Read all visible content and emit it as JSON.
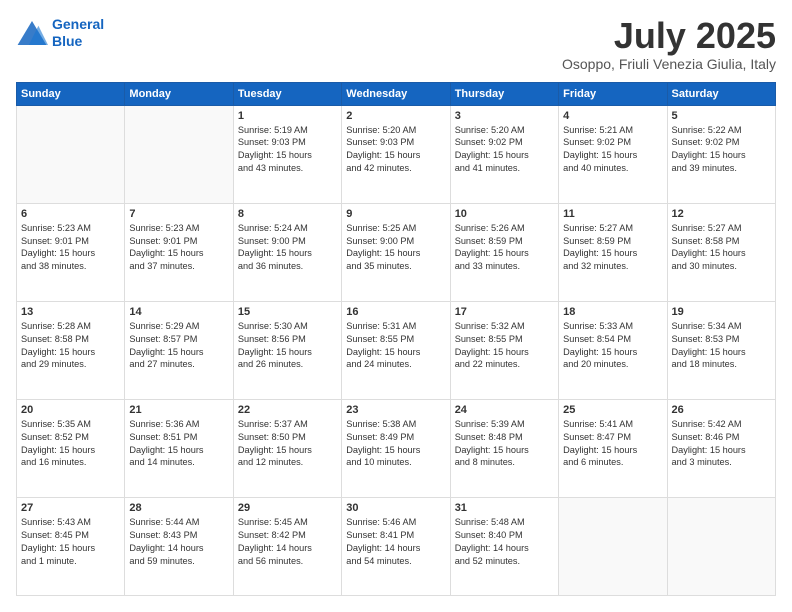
{
  "header": {
    "logo_line1": "General",
    "logo_line2": "Blue",
    "month": "July 2025",
    "location": "Osoppo, Friuli Venezia Giulia, Italy"
  },
  "weekdays": [
    "Sunday",
    "Monday",
    "Tuesday",
    "Wednesday",
    "Thursday",
    "Friday",
    "Saturday"
  ],
  "weeks": [
    [
      {
        "day": "",
        "info": ""
      },
      {
        "day": "",
        "info": ""
      },
      {
        "day": "1",
        "info": "Sunrise: 5:19 AM\nSunset: 9:03 PM\nDaylight: 15 hours\nand 43 minutes."
      },
      {
        "day": "2",
        "info": "Sunrise: 5:20 AM\nSunset: 9:03 PM\nDaylight: 15 hours\nand 42 minutes."
      },
      {
        "day": "3",
        "info": "Sunrise: 5:20 AM\nSunset: 9:02 PM\nDaylight: 15 hours\nand 41 minutes."
      },
      {
        "day": "4",
        "info": "Sunrise: 5:21 AM\nSunset: 9:02 PM\nDaylight: 15 hours\nand 40 minutes."
      },
      {
        "day": "5",
        "info": "Sunrise: 5:22 AM\nSunset: 9:02 PM\nDaylight: 15 hours\nand 39 minutes."
      }
    ],
    [
      {
        "day": "6",
        "info": "Sunrise: 5:23 AM\nSunset: 9:01 PM\nDaylight: 15 hours\nand 38 minutes."
      },
      {
        "day": "7",
        "info": "Sunrise: 5:23 AM\nSunset: 9:01 PM\nDaylight: 15 hours\nand 37 minutes."
      },
      {
        "day": "8",
        "info": "Sunrise: 5:24 AM\nSunset: 9:00 PM\nDaylight: 15 hours\nand 36 minutes."
      },
      {
        "day": "9",
        "info": "Sunrise: 5:25 AM\nSunset: 9:00 PM\nDaylight: 15 hours\nand 35 minutes."
      },
      {
        "day": "10",
        "info": "Sunrise: 5:26 AM\nSunset: 8:59 PM\nDaylight: 15 hours\nand 33 minutes."
      },
      {
        "day": "11",
        "info": "Sunrise: 5:27 AM\nSunset: 8:59 PM\nDaylight: 15 hours\nand 32 minutes."
      },
      {
        "day": "12",
        "info": "Sunrise: 5:27 AM\nSunset: 8:58 PM\nDaylight: 15 hours\nand 30 minutes."
      }
    ],
    [
      {
        "day": "13",
        "info": "Sunrise: 5:28 AM\nSunset: 8:58 PM\nDaylight: 15 hours\nand 29 minutes."
      },
      {
        "day": "14",
        "info": "Sunrise: 5:29 AM\nSunset: 8:57 PM\nDaylight: 15 hours\nand 27 minutes."
      },
      {
        "day": "15",
        "info": "Sunrise: 5:30 AM\nSunset: 8:56 PM\nDaylight: 15 hours\nand 26 minutes."
      },
      {
        "day": "16",
        "info": "Sunrise: 5:31 AM\nSunset: 8:55 PM\nDaylight: 15 hours\nand 24 minutes."
      },
      {
        "day": "17",
        "info": "Sunrise: 5:32 AM\nSunset: 8:55 PM\nDaylight: 15 hours\nand 22 minutes."
      },
      {
        "day": "18",
        "info": "Sunrise: 5:33 AM\nSunset: 8:54 PM\nDaylight: 15 hours\nand 20 minutes."
      },
      {
        "day": "19",
        "info": "Sunrise: 5:34 AM\nSunset: 8:53 PM\nDaylight: 15 hours\nand 18 minutes."
      }
    ],
    [
      {
        "day": "20",
        "info": "Sunrise: 5:35 AM\nSunset: 8:52 PM\nDaylight: 15 hours\nand 16 minutes."
      },
      {
        "day": "21",
        "info": "Sunrise: 5:36 AM\nSunset: 8:51 PM\nDaylight: 15 hours\nand 14 minutes."
      },
      {
        "day": "22",
        "info": "Sunrise: 5:37 AM\nSunset: 8:50 PM\nDaylight: 15 hours\nand 12 minutes."
      },
      {
        "day": "23",
        "info": "Sunrise: 5:38 AM\nSunset: 8:49 PM\nDaylight: 15 hours\nand 10 minutes."
      },
      {
        "day": "24",
        "info": "Sunrise: 5:39 AM\nSunset: 8:48 PM\nDaylight: 15 hours\nand 8 minutes."
      },
      {
        "day": "25",
        "info": "Sunrise: 5:41 AM\nSunset: 8:47 PM\nDaylight: 15 hours\nand 6 minutes."
      },
      {
        "day": "26",
        "info": "Sunrise: 5:42 AM\nSunset: 8:46 PM\nDaylight: 15 hours\nand 3 minutes."
      }
    ],
    [
      {
        "day": "27",
        "info": "Sunrise: 5:43 AM\nSunset: 8:45 PM\nDaylight: 15 hours\nand 1 minute."
      },
      {
        "day": "28",
        "info": "Sunrise: 5:44 AM\nSunset: 8:43 PM\nDaylight: 14 hours\nand 59 minutes."
      },
      {
        "day": "29",
        "info": "Sunrise: 5:45 AM\nSunset: 8:42 PM\nDaylight: 14 hours\nand 56 minutes."
      },
      {
        "day": "30",
        "info": "Sunrise: 5:46 AM\nSunset: 8:41 PM\nDaylight: 14 hours\nand 54 minutes."
      },
      {
        "day": "31",
        "info": "Sunrise: 5:48 AM\nSunset: 8:40 PM\nDaylight: 14 hours\nand 52 minutes."
      },
      {
        "day": "",
        "info": ""
      },
      {
        "day": "",
        "info": ""
      }
    ]
  ]
}
